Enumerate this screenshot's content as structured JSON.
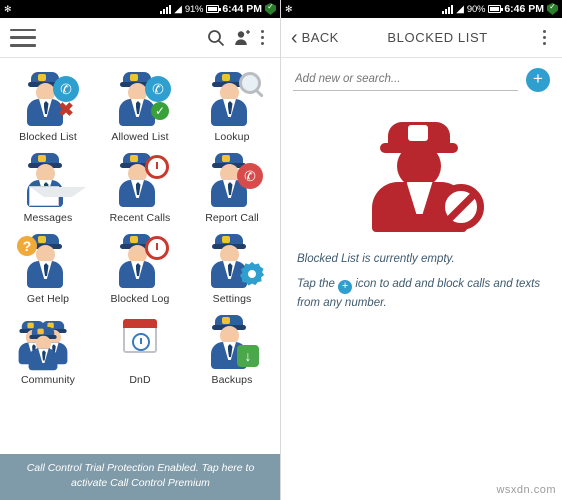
{
  "left": {
    "statusbar": {
      "bt_icon": "bluetooth-icon",
      "signal_icon": "signal-icon",
      "battery_pct": "91%",
      "time": "6:44 PM",
      "shield_icon": "shield-check-icon"
    },
    "actionbar": {
      "menu_icon": "hamburger-menu-icon",
      "search_icon": "search-icon",
      "contact_icon": "add-contact-icon",
      "overflow_icon": "overflow-menu-icon"
    },
    "tiles": [
      {
        "label": "Blocked List",
        "icon": "cop-blocked-list-icon"
      },
      {
        "label": "Allowed List",
        "icon": "cop-allowed-list-icon"
      },
      {
        "label": "Lookup",
        "icon": "cop-lookup-icon"
      },
      {
        "label": "Messages",
        "icon": "cop-messages-icon"
      },
      {
        "label": "Recent Calls",
        "icon": "cop-recent-calls-icon"
      },
      {
        "label": "Report Call",
        "icon": "cop-report-call-icon"
      },
      {
        "label": "Get Help",
        "icon": "cop-get-help-icon"
      },
      {
        "label": "Blocked Log",
        "icon": "cop-blocked-log-icon"
      },
      {
        "label": "Settings",
        "icon": "cop-settings-icon"
      },
      {
        "label": "Community",
        "icon": "cops-community-icon"
      },
      {
        "label": "DnD",
        "icon": "cop-dnd-icon"
      },
      {
        "label": "Backups",
        "icon": "cop-backups-icon"
      }
    ],
    "toast": "Call Control Trial Protection Enabled. Tap here to activate Call Control Premium"
  },
  "right": {
    "statusbar": {
      "bt_icon": "bluetooth-icon",
      "signal_icon": "signal-icon",
      "battery_pct": "90%",
      "time": "6:46 PM",
      "shield_icon": "shield-check-icon"
    },
    "actionbar": {
      "back_arrow": "‹",
      "back_label": "BACK",
      "title": "BLOCKED LIST",
      "overflow_icon": "overflow-menu-icon"
    },
    "search": {
      "placeholder": "Add new or search...",
      "value": "",
      "add_button": "+"
    },
    "empty_state": {
      "illustration": "blocked-officer-illustration",
      "line1": "Blocked List is currently empty.",
      "line2_prefix": "Tap the ",
      "line2_icon": "+",
      "line2_suffix": " icon to add and block calls and texts from any number."
    }
  },
  "watermark": "wsxdn.com",
  "colors": {
    "accent_blue": "#2f9fd0",
    "illustration_red": "#b7272d",
    "toast_bg": "#7f9aa8",
    "statusbar_bg": "#000000"
  }
}
